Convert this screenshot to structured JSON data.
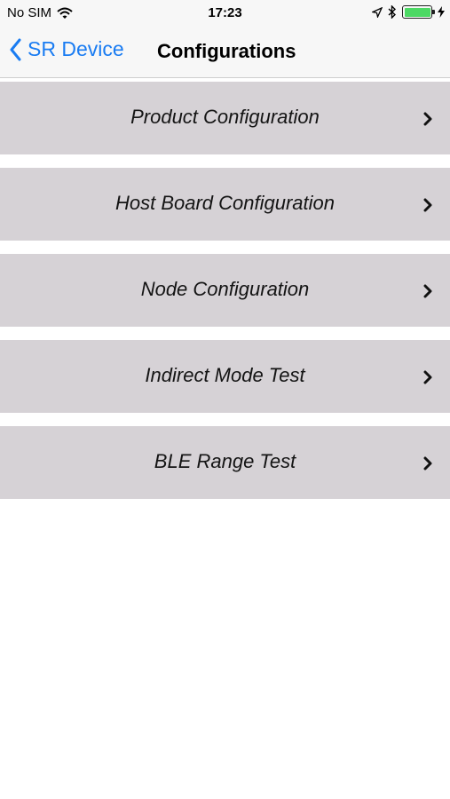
{
  "status_bar": {
    "carrier": "No SIM",
    "time": "17:23",
    "battery_color": "#4cd964"
  },
  "nav": {
    "back_label": "SR Device",
    "title": "Configurations",
    "accent_color": "#1a7cf2"
  },
  "menu": {
    "items": [
      {
        "label": "Product Configuration"
      },
      {
        "label": "Host Board Configuration"
      },
      {
        "label": "Node Configuration"
      },
      {
        "label": "Indirect Mode Test"
      },
      {
        "label": "BLE Range Test"
      }
    ],
    "row_color": "#d6d2d6"
  },
  "icons": [
    "wifi-icon",
    "location-icon",
    "bluetooth-icon",
    "battery-icon",
    "charging-icon",
    "back-chevron-icon",
    "chevron-right-icon"
  ]
}
